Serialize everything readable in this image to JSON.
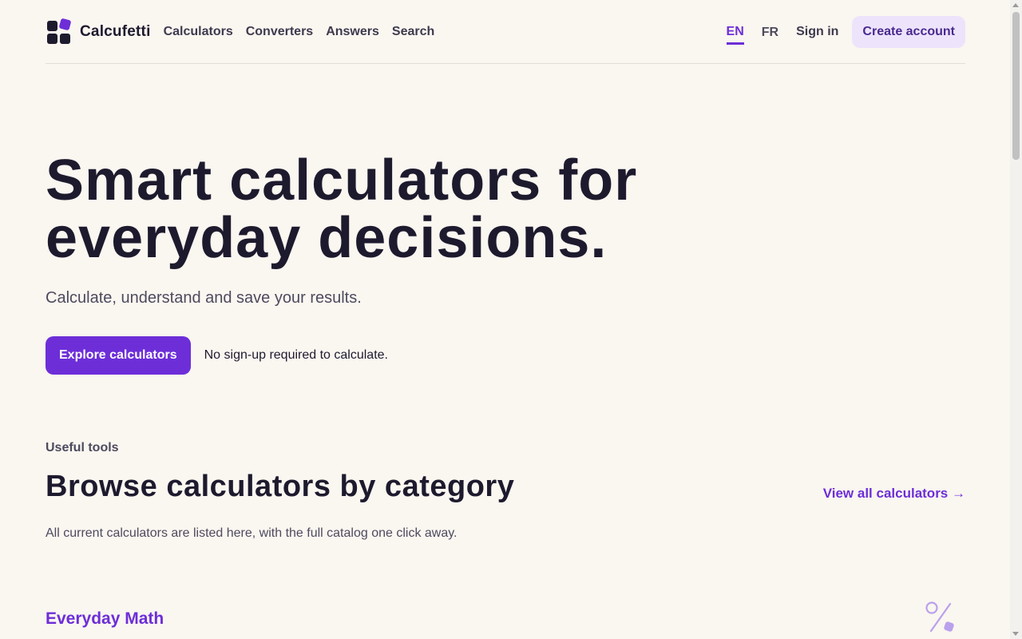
{
  "header": {
    "brand": "Calcufetti",
    "nav": [
      "Calculators",
      "Converters",
      "Answers",
      "Search"
    ],
    "languages": [
      "EN",
      "FR"
    ],
    "active_language": "EN",
    "sign_in": "Sign in",
    "create_account": "Create account"
  },
  "hero": {
    "title_line1": "Smart calculators for",
    "title_line2": "everyday decisions.",
    "subtitle": "Calculate, understand and save your results.",
    "cta": "Explore calculators",
    "cta_note": "No sign-up required to calculate."
  },
  "categories": {
    "eyebrow": "Useful tools",
    "title": "Browse calculators by category",
    "view_all": "View all calculators →",
    "description": "All current calculators are listed here, with the full catalog one click away.",
    "first_category": "Everyday Math",
    "first_category_icon": "percent-icon"
  },
  "colors": {
    "accent": "#6d2ed8",
    "background": "#faf6f0",
    "text": "#1e1a2e",
    "accent_soft": "#ede4fb"
  }
}
